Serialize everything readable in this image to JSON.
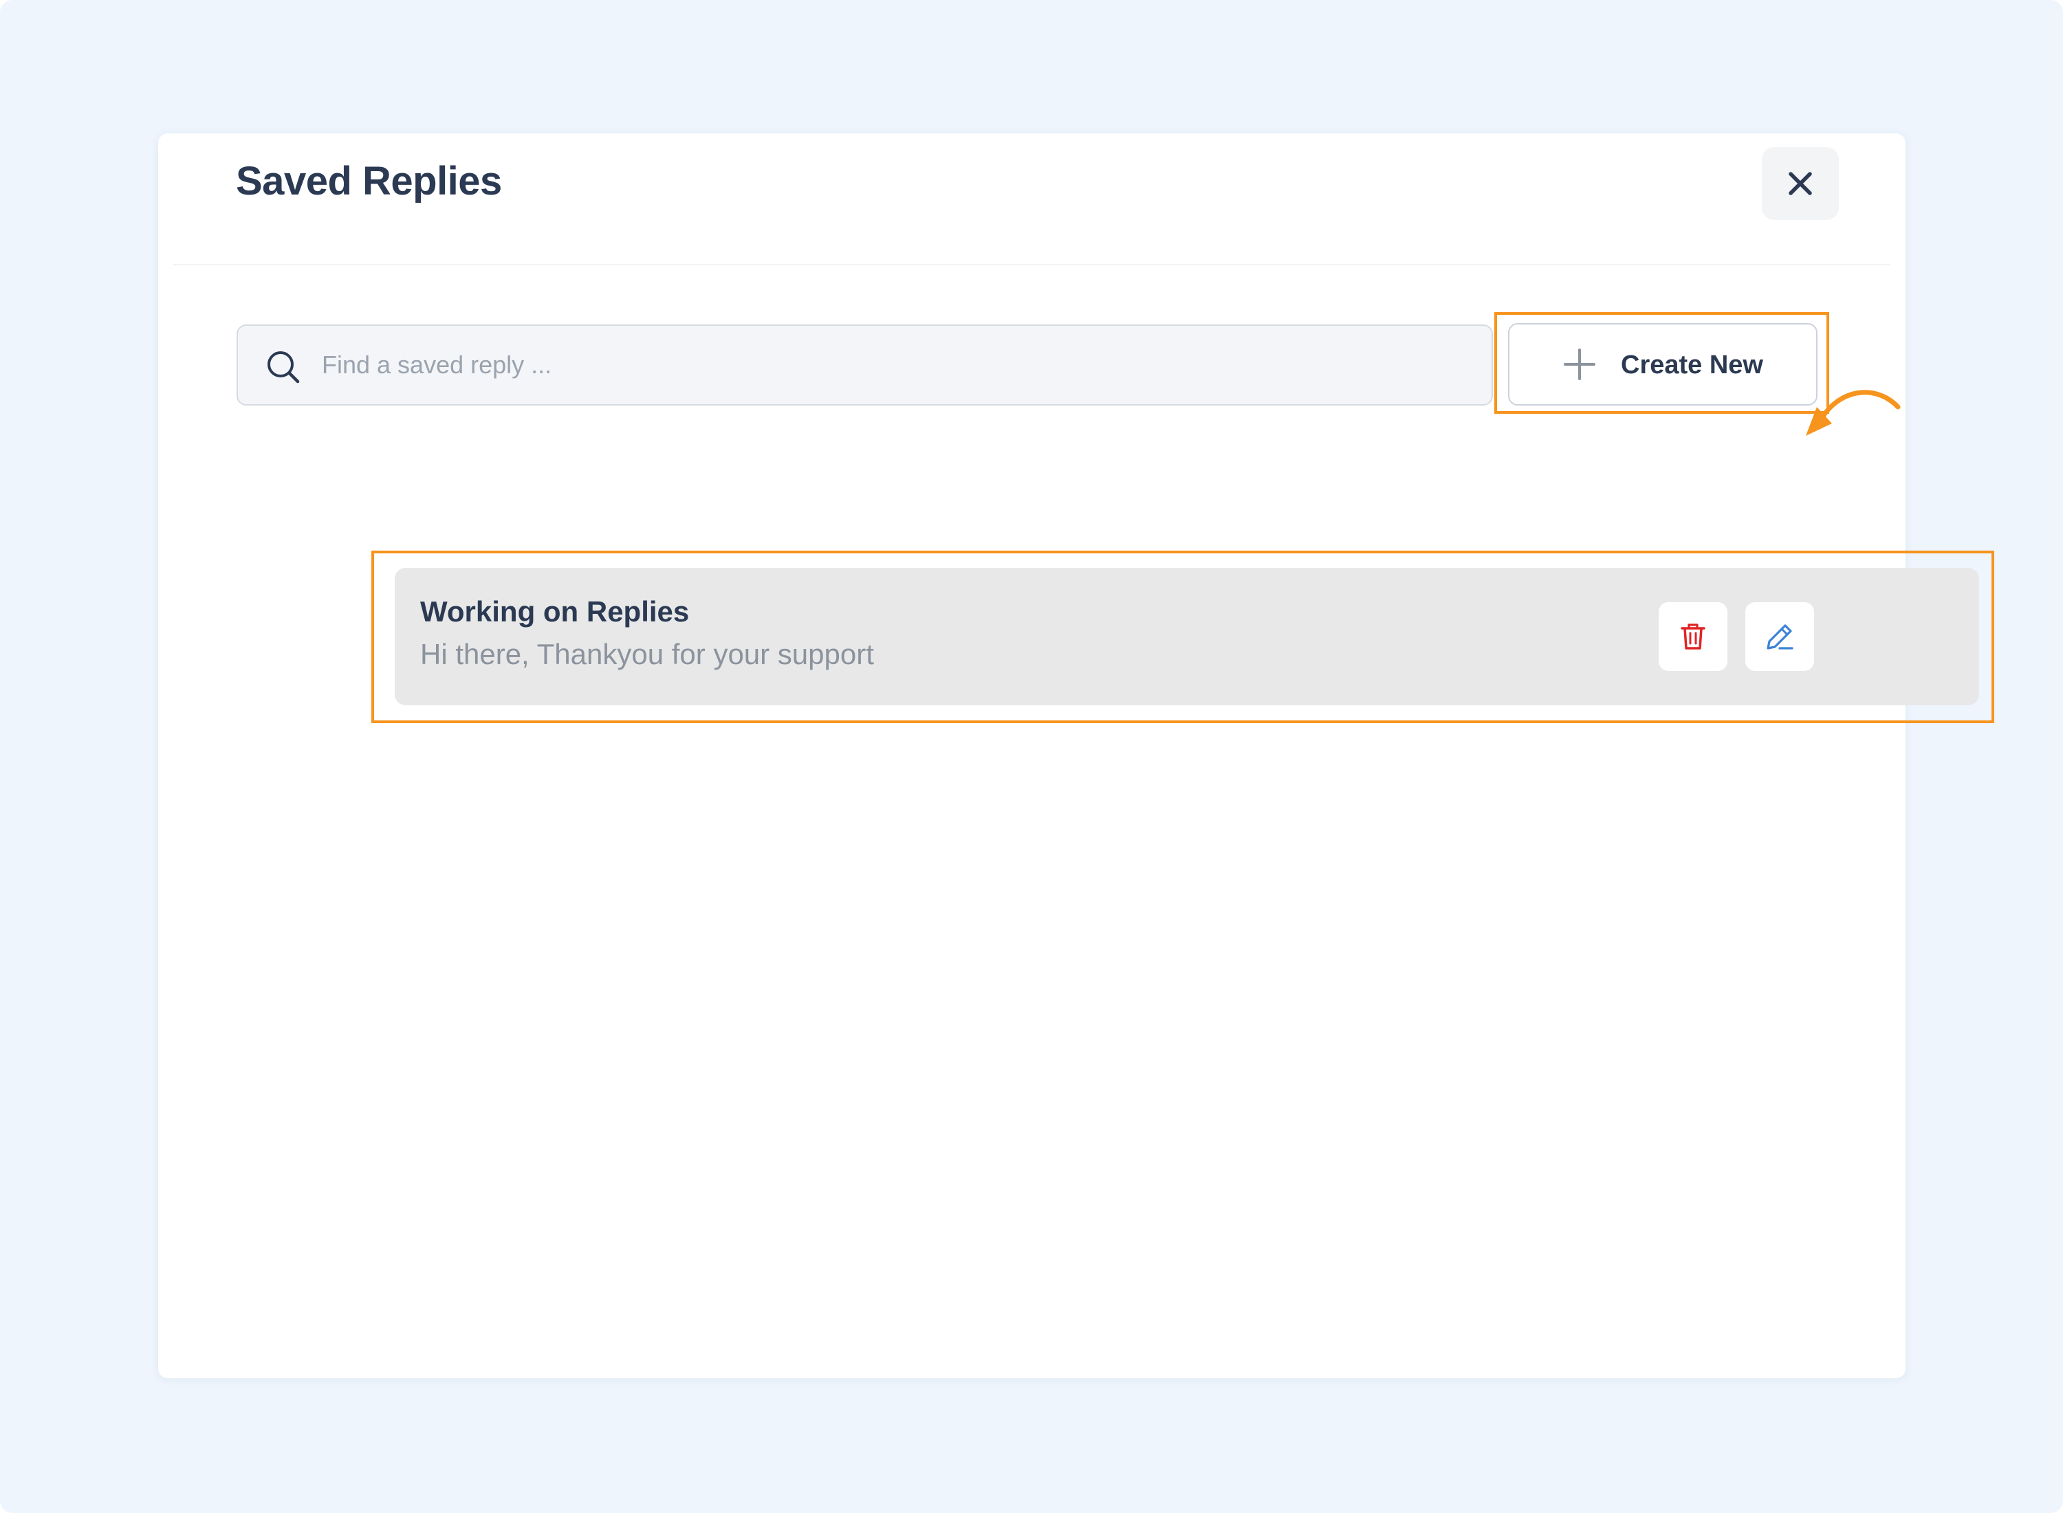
{
  "modal": {
    "title": "Saved Replies"
  },
  "search": {
    "placeholder": "Find a saved reply ..."
  },
  "toolbar": {
    "create_label": "Create New"
  },
  "replies": [
    {
      "title": "Working on Replies",
      "body": "Hi there, Thankyou for your support"
    }
  ],
  "icons": {
    "close": "close-icon",
    "search": "search-icon",
    "create": "plus-icon",
    "delete": "trash-icon",
    "edit": "pencil-icon",
    "callout": "curved-arrow-icon"
  },
  "colors": {
    "background": "#eef5fd",
    "title_text": "#2b3a52",
    "highlight": "#f7941d",
    "delete_icon": "#e02424",
    "edit_icon": "#3b82d6",
    "reply_card": "#e8e8e9"
  }
}
